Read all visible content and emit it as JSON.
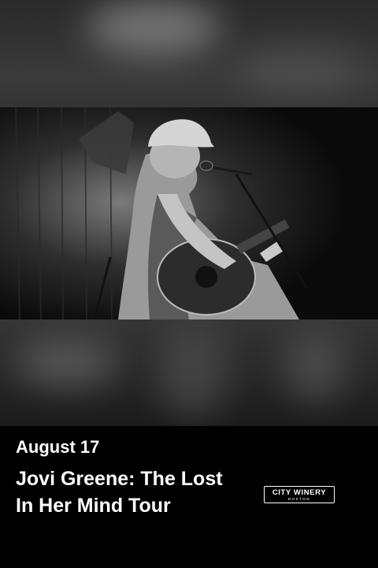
{
  "event": {
    "date": "August 17",
    "title": "Jovi Greene: The Lost In Her Mind Tour"
  },
  "venue_logo": {
    "name": "CITY WINERY",
    "location": "BOSTON"
  }
}
